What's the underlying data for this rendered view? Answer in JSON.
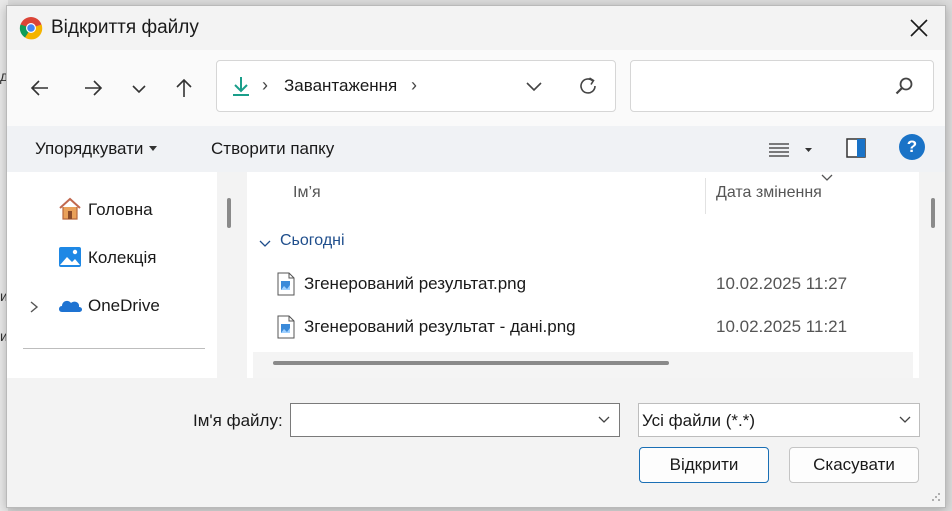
{
  "window": {
    "title": "Відкриття файлу"
  },
  "background": {
    "marks": [
      "д",
      "и",
      "и"
    ]
  },
  "address": {
    "location": "Завантаження",
    "separator": "›"
  },
  "search": {
    "placeholder": "",
    "value": ""
  },
  "toolbar": {
    "organize_label": "Упорядкувати",
    "new_folder_label": "Створити папку",
    "help_label": "?"
  },
  "sidebar": {
    "items": [
      {
        "label": "Головна",
        "icon": "home-icon"
      },
      {
        "label": "Колекція",
        "icon": "gallery-icon"
      },
      {
        "label": "OneDrive",
        "icon": "onedrive-icon"
      }
    ]
  },
  "files": {
    "columns": {
      "name": "Ім’я",
      "date": "Дата змінення"
    },
    "group": "Сьогодні",
    "rows": [
      {
        "name": "Згенерований результат.png",
        "date": "10.02.2025 11:27"
      },
      {
        "name": "Згенерований результат - дані.png",
        "date": "10.02.2025 11:21"
      }
    ]
  },
  "footer": {
    "filename_label": "Ім'я файлу:",
    "filename_value": "",
    "filter_value": "Усі файли (*.*)",
    "open_label": "Відкрити",
    "cancel_label": "Скасувати"
  },
  "colors": {
    "accent": "#1a73c7",
    "download_green": "#1a9e8a",
    "group_text": "#1f4e8c"
  }
}
